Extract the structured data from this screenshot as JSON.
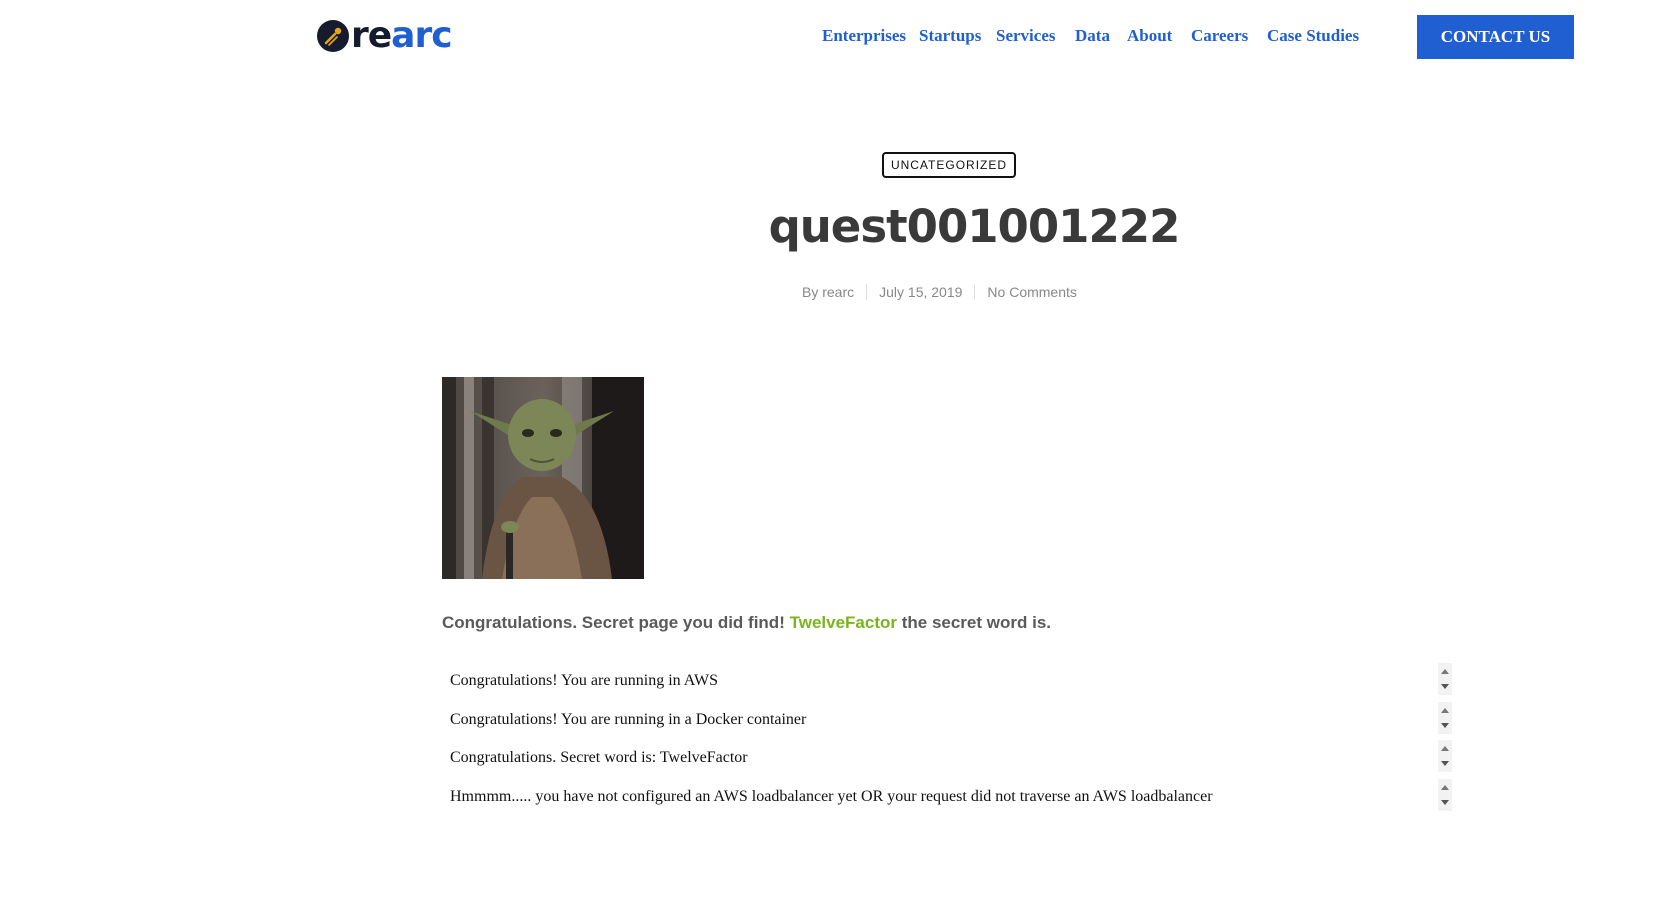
{
  "header": {
    "logo_re": "re",
    "logo_arc": "arc",
    "nav": [
      "Enterprises",
      "Startups",
      "Services",
      "Data",
      "About",
      "Careers",
      "Case Studies"
    ],
    "contact_label": "CONTACT US"
  },
  "post": {
    "category": "UNCATEGORIZED",
    "title": "quest001001222",
    "author": "By rearc",
    "date": "July 15, 2019",
    "comments": "No Comments",
    "image_icon": "yoda-image",
    "intro_before": "Congratulations. Secret page you did find!",
    "secret_word": "TwelveFactor",
    "intro_after": "the secret word is.",
    "frames": [
      "Congratulations! You are running in AWS",
      "Congratulations! You are running in a Docker container",
      "Congratulations. Secret word is: TwelveFactor",
      "Hmmmm..... you have not configured an AWS loadbalancer yet OR your request did not traverse an AWS loadbalancer"
    ]
  },
  "colors": {
    "brand_blue": "#1f5fd1",
    "secret_green": "#7ab51d"
  }
}
